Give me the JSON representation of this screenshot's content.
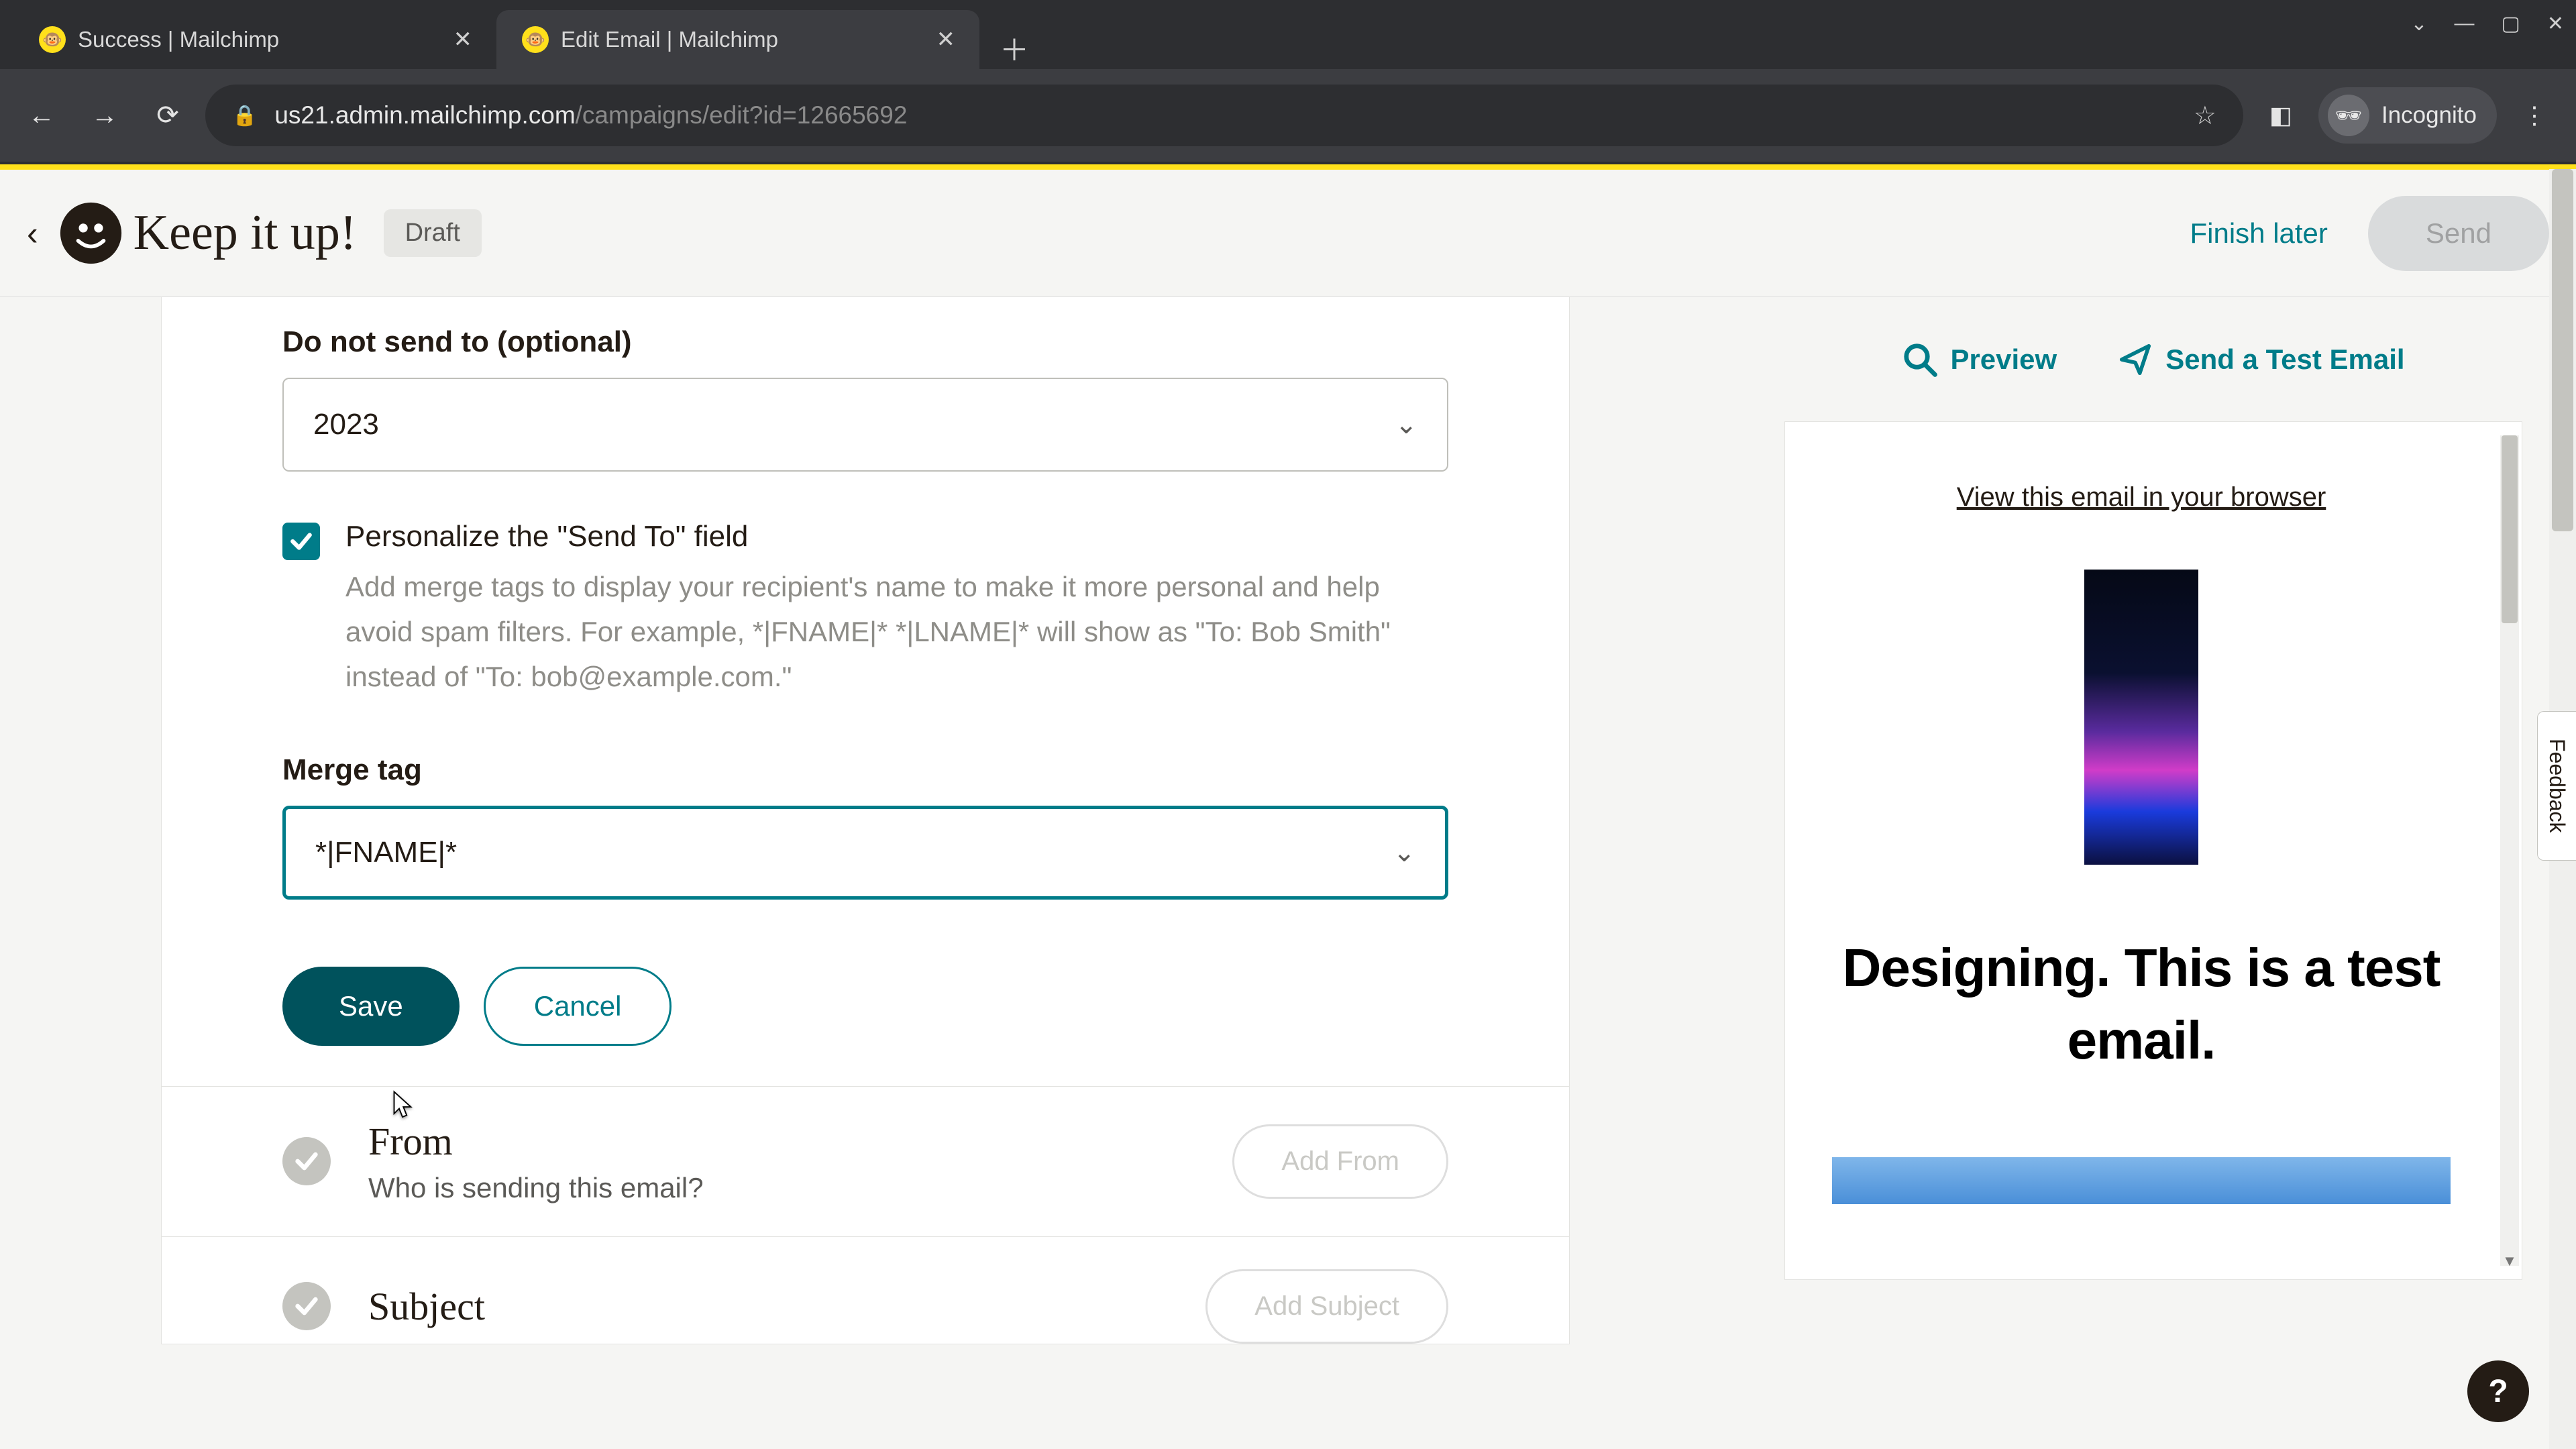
{
  "browser": {
    "tabs": [
      {
        "title": "Success | Mailchimp",
        "active": false
      },
      {
        "title": "Edit Email | Mailchimp",
        "active": true
      }
    ],
    "url_host": "us21.admin.mailchimp.com",
    "url_path": "/campaigns/edit?id=12665692",
    "incognito_label": "Incognito",
    "window_controls": {
      "min": "—",
      "max": "▢",
      "close": "✕"
    }
  },
  "header": {
    "campaign_title": "Keep it up!",
    "status_badge": "Draft",
    "finish_later": "Finish later",
    "send": "Send"
  },
  "form": {
    "do_not_send_label": "Do not send to (optional)",
    "do_not_send_value": "2023",
    "personalize_checked": true,
    "personalize_title": "Personalize the \"Send To\" field",
    "personalize_desc": "Add merge tags to display your recipient's name to make it more personal and help avoid spam filters. For example, *|FNAME|* *|LNAME|* will show as \"To: Bob Smith\" instead of \"To: bob@example.com.\"",
    "merge_tag_label": "Merge tag",
    "merge_tag_value": "*|FNAME|*",
    "save": "Save",
    "cancel": "Cancel"
  },
  "sections": {
    "from": {
      "title": "From",
      "subtitle": "Who is sending this email?",
      "button": "Add From"
    },
    "subject": {
      "title": "Subject",
      "button": "Add Subject"
    }
  },
  "sidebar": {
    "preview": "Preview",
    "send_test": "Send a Test Email",
    "view_in_browser": "View this email in your browser",
    "preview_heading": "Designing. This is a test email."
  },
  "misc": {
    "feedback": "Feedback",
    "help": "?"
  }
}
